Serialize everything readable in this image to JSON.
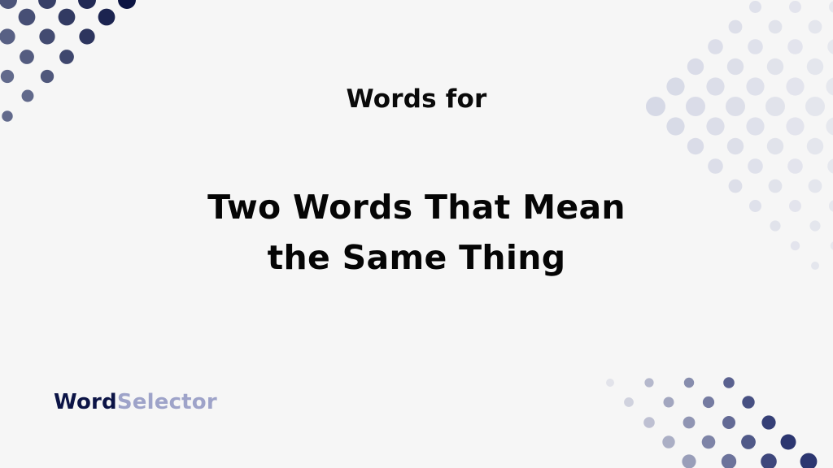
{
  "subtitle": "Words for",
  "title": {
    "line1": "Two Words That Mean",
    "line2": "the Same Thing"
  },
  "logo": {
    "part1": "Word",
    "part2": "Selector"
  },
  "colors": {
    "background": "#f6f6f6",
    "text": "#050505",
    "logo_primary": "#0c1446",
    "logo_secondary": "#9ea3c9",
    "dot_dark": "#0c1446",
    "dot_light": "#d6d9e6"
  },
  "decorations": {
    "top_left": "dot-pattern-dark",
    "top_right": "dot-pattern-light",
    "bottom_right": "dot-pattern-gradient"
  }
}
